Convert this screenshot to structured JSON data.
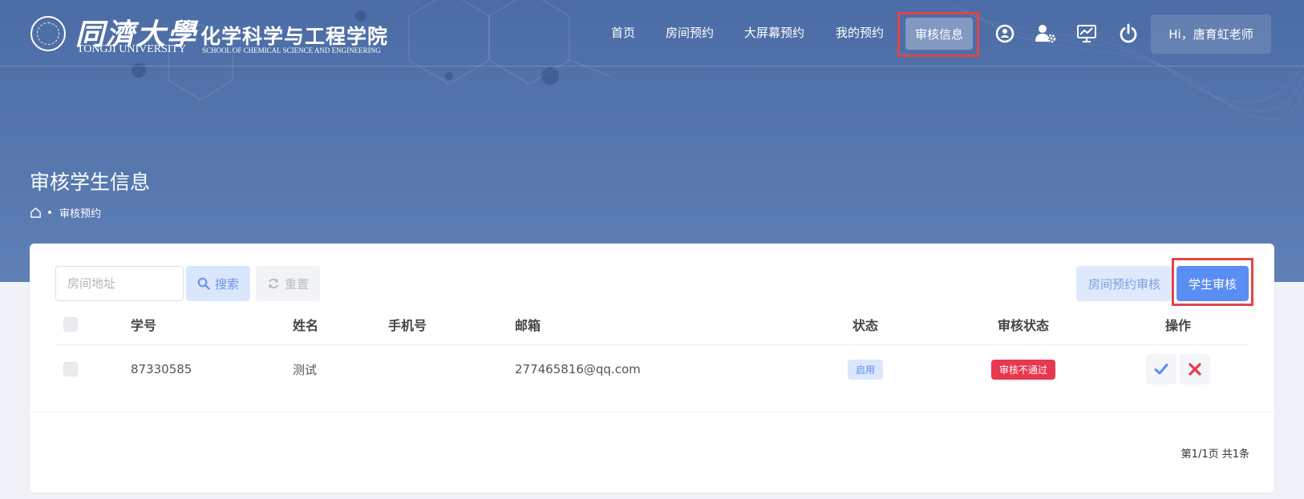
{
  "header": {
    "logo": {
      "university_cn": "同濟大學",
      "university_en": "TONGJI UNIVERSITY",
      "department_cn": "化学科学与工程学院",
      "department_en": "SCHOOL OF CHEMICAL SCIENCE AND ENGINEERING"
    },
    "nav": [
      {
        "label": "首页"
      },
      {
        "label": "房间预约"
      },
      {
        "label": "大屏幕预约"
      },
      {
        "label": "我的预约"
      },
      {
        "label": "审核信息",
        "active": true
      }
    ],
    "icons": [
      "lock-user-icon",
      "user-settings-icon",
      "monitor-chart-icon",
      "power-icon"
    ],
    "user_greeting": "Hi，唐育虹老师"
  },
  "page": {
    "title": "审核学生信息",
    "breadcrumb": {
      "home_icon": "home-icon",
      "current": "审核预约"
    }
  },
  "toolbar": {
    "search_placeholder": "房间地址",
    "search_label": "搜索",
    "reset_label": "重置",
    "tab_room_review": "房间预约审核",
    "tab_student_review": "学生审核"
  },
  "table": {
    "columns": [
      "学号",
      "姓名",
      "手机号",
      "邮箱",
      "状态",
      "审核状态",
      "操作"
    ],
    "rows": [
      {
        "student_id": "87330585",
        "name": "测试",
        "phone": "",
        "email": "277465816@qq.com",
        "status": "启用",
        "review_status": "审核不通过"
      }
    ]
  },
  "pagination": {
    "summary": "第1/1页 共1条"
  },
  "colors": {
    "hero": "#4b6ca5",
    "primary": "#5b8ef2",
    "danger": "#e8384f",
    "highlight": "#e0454a"
  }
}
